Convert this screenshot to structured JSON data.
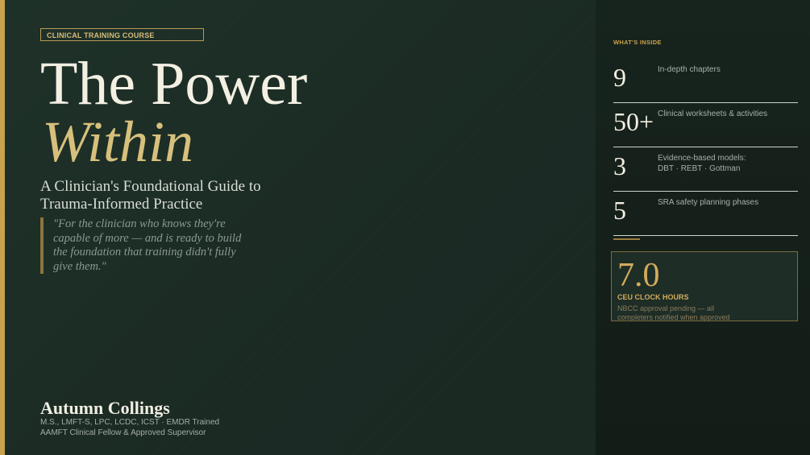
{
  "course": {
    "tag": "CLINICAL TRAINING COURSE",
    "title_line1": "The Power",
    "title_line2": "Within",
    "subtitle": "A Clinician's Foundational Guide to Trauma-Informed Practice",
    "quote": "\"For the clinician who knows they're capable of more — and is ready to build the foundation that training didn't fully give them.\""
  },
  "author": {
    "name": "Autumn Collings",
    "credentials_line1": "M.S., LMFT-S, LPC, LCDC, ICST  ·  EMDR Trained",
    "credentials_line2": "AAMFT Clinical Fellow & Approved Supervisor"
  },
  "sidebar": {
    "heading": "WHAT'S INSIDE",
    "stats": [
      {
        "number": "9",
        "description": "In-depth chapters"
      },
      {
        "number": "50+",
        "description": "Clinical worksheets & activities"
      },
      {
        "number": "3",
        "description": "Evidence-based models: DBT · REBT · Gottman"
      },
      {
        "number": "5",
        "description": "SRA safety planning phases"
      }
    ],
    "ceu": {
      "hours": "7.0",
      "label": "CEU CLOCK HOURS",
      "note": "NBCC approval pending — all completers notified when approved"
    }
  },
  "colors": {
    "accent_gold": "#c9a24e",
    "background_green": "#1c2b24",
    "title_cream": "#f3efe3",
    "italic_gold": "#d7c07c"
  }
}
